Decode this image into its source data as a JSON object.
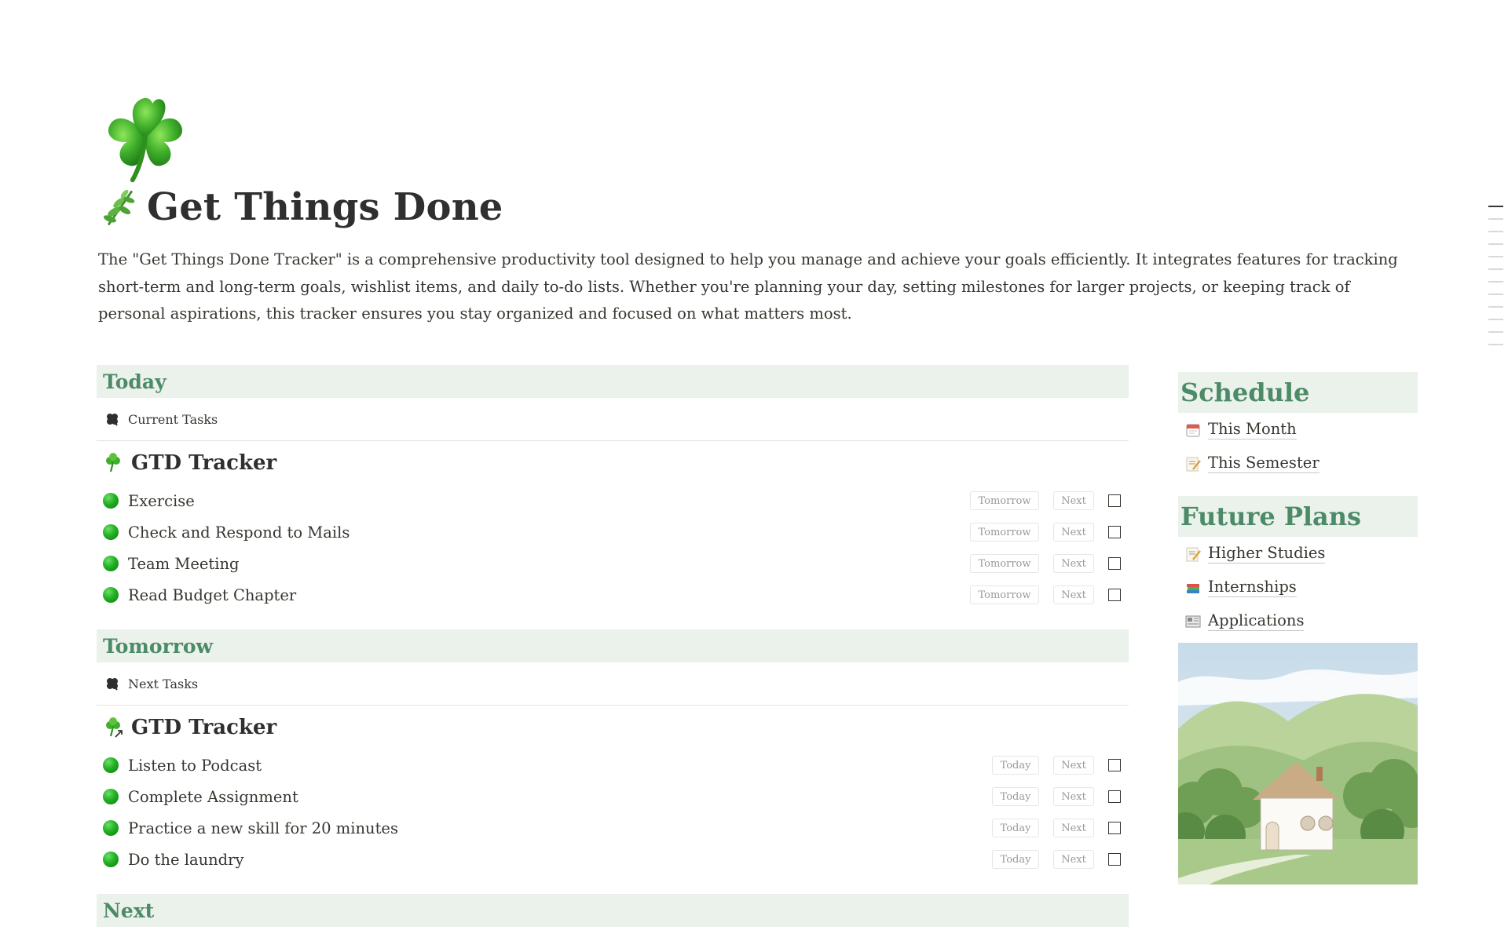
{
  "page": {
    "icon": "shamrock-icon",
    "title_icon": "herb-icon",
    "title": "Get Things Done",
    "description": "The \"Get Things Done Tracker\" is a comprehensive productivity tool designed to help you manage and achieve your goals efficiently. It integrates features for tracking short-term and long-term goals, wishlist items, and daily to-do lists. Whether you're planning your day, setting milestones for larger projects, or keeping track of personal aspirations, this tracker ensures you stay organized and focused on what matters most."
  },
  "colors": {
    "accent": "#4c8b67",
    "section_bg": "#ebf1eb",
    "text": "#37352f",
    "chip_text": "#9b9a97"
  },
  "sections": [
    {
      "heading": "Today",
      "view_tab": "Current Tasks",
      "group_title": "GTD Tracker",
      "tasks": [
        {
          "name": "Exercise",
          "move_label": "Tomorrow",
          "next_label": "Next"
        },
        {
          "name": "Check and Respond to Mails",
          "move_label": "Tomorrow",
          "next_label": "Next"
        },
        {
          "name": "Team Meeting",
          "move_label": "Tomorrow",
          "next_label": "Next"
        },
        {
          "name": "Read Budget Chapter",
          "move_label": "Tomorrow",
          "next_label": "Next"
        }
      ]
    },
    {
      "heading": "Tomorrow",
      "view_tab": "Next Tasks",
      "group_title": "GTD Tracker",
      "tasks": [
        {
          "name": "Listen to Podcast",
          "move_label": "Today",
          "next_label": "Next"
        },
        {
          "name": "Complete Assignment",
          "move_label": "Today",
          "next_label": "Next"
        },
        {
          "name": "Practice a new skill for 20 minutes",
          "move_label": "Today",
          "next_label": "Next"
        },
        {
          "name": "Do the laundry",
          "move_label": "Today",
          "next_label": "Next"
        }
      ]
    },
    {
      "heading": "Next"
    }
  ],
  "sidebar": {
    "schedule": {
      "heading": "Schedule",
      "links": [
        {
          "label": "This Month",
          "icon": "calendar-icon"
        },
        {
          "label": "This Semester",
          "icon": "memo-icon"
        }
      ]
    },
    "future_plans": {
      "heading": "Future Plans",
      "links": [
        {
          "label": "Higher Studies",
          "icon": "memo-icon"
        },
        {
          "label": "Internships",
          "icon": "books-icon"
        },
        {
          "label": "Applications",
          "icon": "newspaper-icon"
        }
      ]
    }
  }
}
